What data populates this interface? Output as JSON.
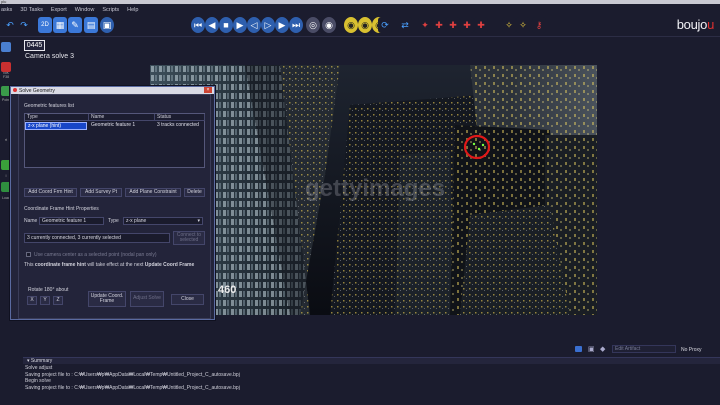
{
  "app": {
    "title_fragment": "plu",
    "brand_prefix": "boujo",
    "brand_suffix": "u"
  },
  "menu": [
    "asks",
    "3D Tasks",
    "Export",
    "Window",
    "Scripts",
    "Help"
  ],
  "toolbar": {
    "icons": [
      {
        "name": "undo-icon",
        "glyph": "↶",
        "color": "#4aa0ff",
        "bg": "#1b1c2e"
      },
      {
        "name": "redo-icon",
        "glyph": "↷",
        "color": "#4aa0ff",
        "bg": "#1b1c2e"
      },
      {
        "name": "2d-view-icon",
        "glyph": "2D",
        "color": "#ffffff",
        "bg": "#3b78d8"
      },
      {
        "name": "layout-icon",
        "glyph": "▦",
        "color": "#ffffff",
        "bg": "#3b78d8"
      },
      {
        "name": "track-icon",
        "glyph": "✎",
        "color": "#ffffff",
        "bg": "#3b78d8"
      },
      {
        "name": "graph-icon",
        "glyph": "▤",
        "color": "#ffffff",
        "bg": "#3b78d8"
      },
      {
        "name": "image-icon",
        "glyph": "▣",
        "color": "#ffffff",
        "bg": "#2e5fae"
      },
      {
        "name": "first-frame-icon",
        "glyph": "⏮",
        "color": "#ffffff",
        "bg": "#2e5fae"
      },
      {
        "name": "prev-key-icon",
        "glyph": "◀",
        "color": "#ffffff",
        "bg": "#2e5fae"
      },
      {
        "name": "stop-icon",
        "glyph": "■",
        "color": "#ffffff",
        "bg": "#2e5fae"
      },
      {
        "name": "play-icon",
        "glyph": "▶",
        "color": "#ffffff",
        "bg": "#2e5fae"
      },
      {
        "name": "step-back-icon",
        "glyph": "◁",
        "color": "#ffffff",
        "bg": "#2e5fae"
      },
      {
        "name": "step-fwd-icon",
        "glyph": "▷",
        "color": "#ffffff",
        "bg": "#2e5fae"
      },
      {
        "name": "next-key-icon",
        "glyph": "▶",
        "color": "#ffffff",
        "bg": "#2e5fae"
      },
      {
        "name": "last-frame-icon",
        "glyph": "⏭",
        "color": "#ffffff",
        "bg": "#2e5fae"
      },
      {
        "name": "zoom-icon",
        "glyph": "◎",
        "color": "#ffffff",
        "bg": "#4a4c66"
      },
      {
        "name": "fit-icon",
        "glyph": "◉",
        "color": "#ffffff",
        "bg": "#4a4c66"
      },
      {
        "name": "marker-a-icon",
        "glyph": "◉",
        "color": "#222222",
        "bg": "#d8c030"
      },
      {
        "name": "marker-b-icon",
        "glyph": "◉",
        "color": "#222222",
        "bg": "#d8c030"
      },
      {
        "name": "marker-c-icon",
        "glyph": "◉",
        "color": "#222222",
        "bg": "#d8c030"
      },
      {
        "name": "loop-icon",
        "glyph": "⟳",
        "color": "#4aa0ff",
        "bg": "#1b1c2e"
      },
      {
        "name": "swap-icon",
        "glyph": "⇄",
        "color": "#4aa0ff",
        "bg": "#1b1c2e"
      },
      {
        "name": "locator-icon",
        "glyph": "✦",
        "color": "#e04040",
        "bg": "#1b1c2e"
      },
      {
        "name": "pin-a-icon",
        "glyph": "✚",
        "color": "#e04040",
        "bg": "#1b1c2e"
      },
      {
        "name": "pin-b-icon",
        "glyph": "✚",
        "color": "#e04040",
        "bg": "#1b1c2e"
      },
      {
        "name": "pin-c-icon",
        "glyph": "✚",
        "color": "#e04040",
        "bg": "#1b1c2e"
      },
      {
        "name": "pin-d-icon",
        "glyph": "✚",
        "color": "#e04040",
        "bg": "#1b1c2e"
      },
      {
        "name": "wand-a-icon",
        "glyph": "✧",
        "color": "#f0d040",
        "bg": "#1b1c2e"
      },
      {
        "name": "wand-b-icon",
        "glyph": "✧",
        "color": "#f0d040",
        "bg": "#1b1c2e"
      },
      {
        "name": "key-icon",
        "glyph": "⚷",
        "color": "#e04040",
        "bg": "#1b1c2e"
      }
    ]
  },
  "left_strip": {
    "labels": [
      "NIK F38",
      "Point",
      "rt",
      "l",
      "Load"
    ]
  },
  "frame_number": "0445",
  "camera_title": "Camera solve 3",
  "viewport": {
    "overlay_frame": "460",
    "watermark": "gettyimages"
  },
  "dialog": {
    "title": "Solve Geometry",
    "features_label": "Geometric features list",
    "columns": [
      "Type",
      "Name",
      "Status"
    ],
    "rows": [
      {
        "type": "z-x plane (hint)",
        "name": "Geometric feature 1",
        "status": "3 tracks connected"
      }
    ],
    "buttons": {
      "add_coord": "Add Coord Frm Hint",
      "add_survey": "Add Survey Pt",
      "add_plane": "Add Plane Constraint",
      "delete": "Delete"
    },
    "props_label": "Coordinate Frame Hint Properties",
    "name_label": "Name",
    "name_value": "Geometric feature 1",
    "type_label": "Type",
    "type_value": "z-x plane",
    "connected_text": "3 currently connected, 3 currently selected",
    "connect_btn": "Connect to selected",
    "camera_center_label": "Use camera center as a selected point (nodal pan only)",
    "info_pre": "This ",
    "info_bold1": "coordinate frame hint",
    "info_mid": " will take effect at the next ",
    "info_bold2": "Update Coord Frame",
    "rotate_label": "Rotate 180° about",
    "axis": [
      "X",
      "Y",
      "Z"
    ],
    "update_btn": "Update Coord. Frame",
    "adjust_btn": "Adjust Solve",
    "close_btn": "Close"
  },
  "status": {
    "edit_artifact": "Edit Artifact",
    "proxy": "No Proxy"
  },
  "summary": {
    "label": "Summary",
    "lines": [
      "Solve adjust",
      "Saving project file to : C:₩Users₩p₩AppData₩Local₩Temp₩Untitled_Project_C_autosave.bpj",
      "Begin solve",
      "Saving project file to : C:₩Users₩p₩AppData₩Local₩Temp₩Untitled_Project_C_autosave.bpj"
    ]
  }
}
